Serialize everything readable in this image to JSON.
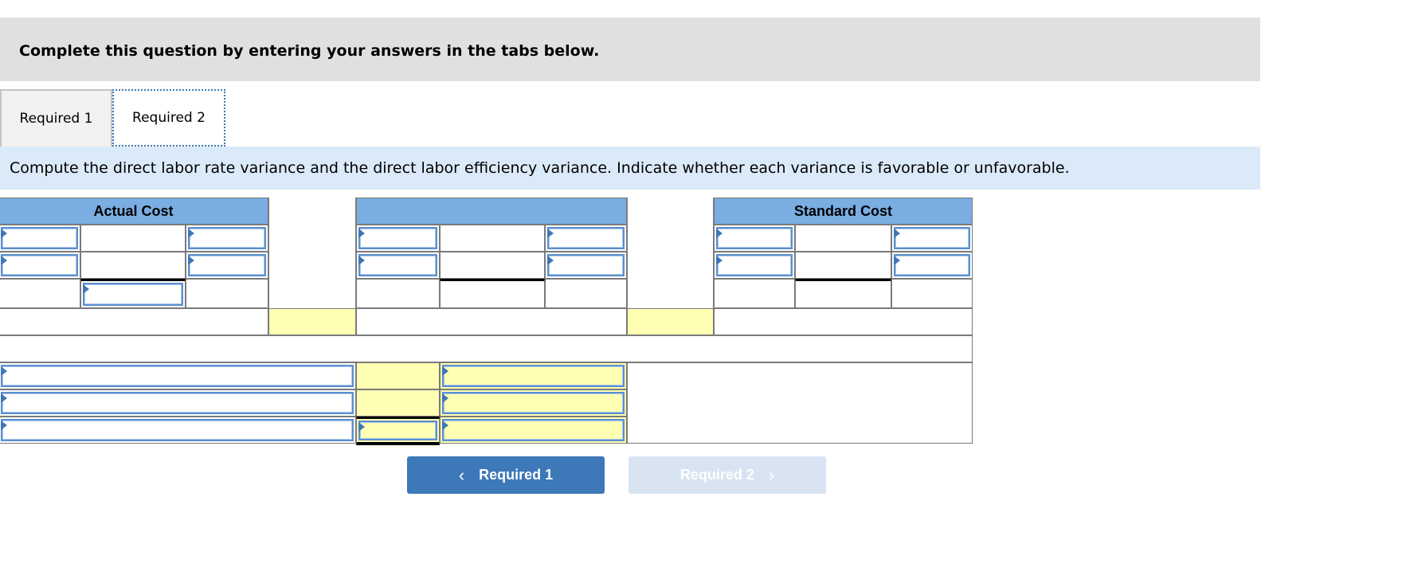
{
  "instructions": {
    "text": "Complete this question by entering your answers in the tabs below."
  },
  "tabs": [
    {
      "label": "Required 1",
      "active": false
    },
    {
      "label": "Required 2",
      "active": true
    }
  ],
  "prompt": {
    "text": "Compute the direct labor rate variance and the direct labor efficiency variance. Indicate whether each variance is favorable or unfavorable."
  },
  "table": {
    "headers": {
      "actual_cost": "Actual Cost",
      "middle": "",
      "standard_cost": "Standard Cost"
    },
    "inputs": {
      "actual_r1_c1": "",
      "actual_r1_c3": "",
      "actual_r2_c1": "",
      "actual_r2_c3": "",
      "actual_r3_c2": "",
      "middle_r1_c1": "",
      "middle_r1_c3": "",
      "middle_r2_c1": "",
      "middle_r2_c3": "",
      "standard_r1_c1": "",
      "standard_r1_c3": "",
      "standard_r2_c1": "",
      "standard_r2_c3": "",
      "variance_label_1": "",
      "variance_label_2": "",
      "variance_label_3": "",
      "variance_amount_3": "",
      "variance_type_1": "",
      "variance_type_2": "",
      "variance_type_3": ""
    }
  },
  "nav": {
    "prev_label": "Required 1",
    "next_label": "Required 2",
    "prev_icon": "chevron-left-icon",
    "next_icon": "chevron-right-icon",
    "next_disabled": true
  },
  "colors": {
    "header_blue": "#7aade2",
    "prompt_bg": "#dbeaf8",
    "instr_bg": "#e0e0e0",
    "answer_yellow": "#ffffb3",
    "button_blue": "#3d78b9",
    "button_disabled": "#d8e4f2"
  }
}
